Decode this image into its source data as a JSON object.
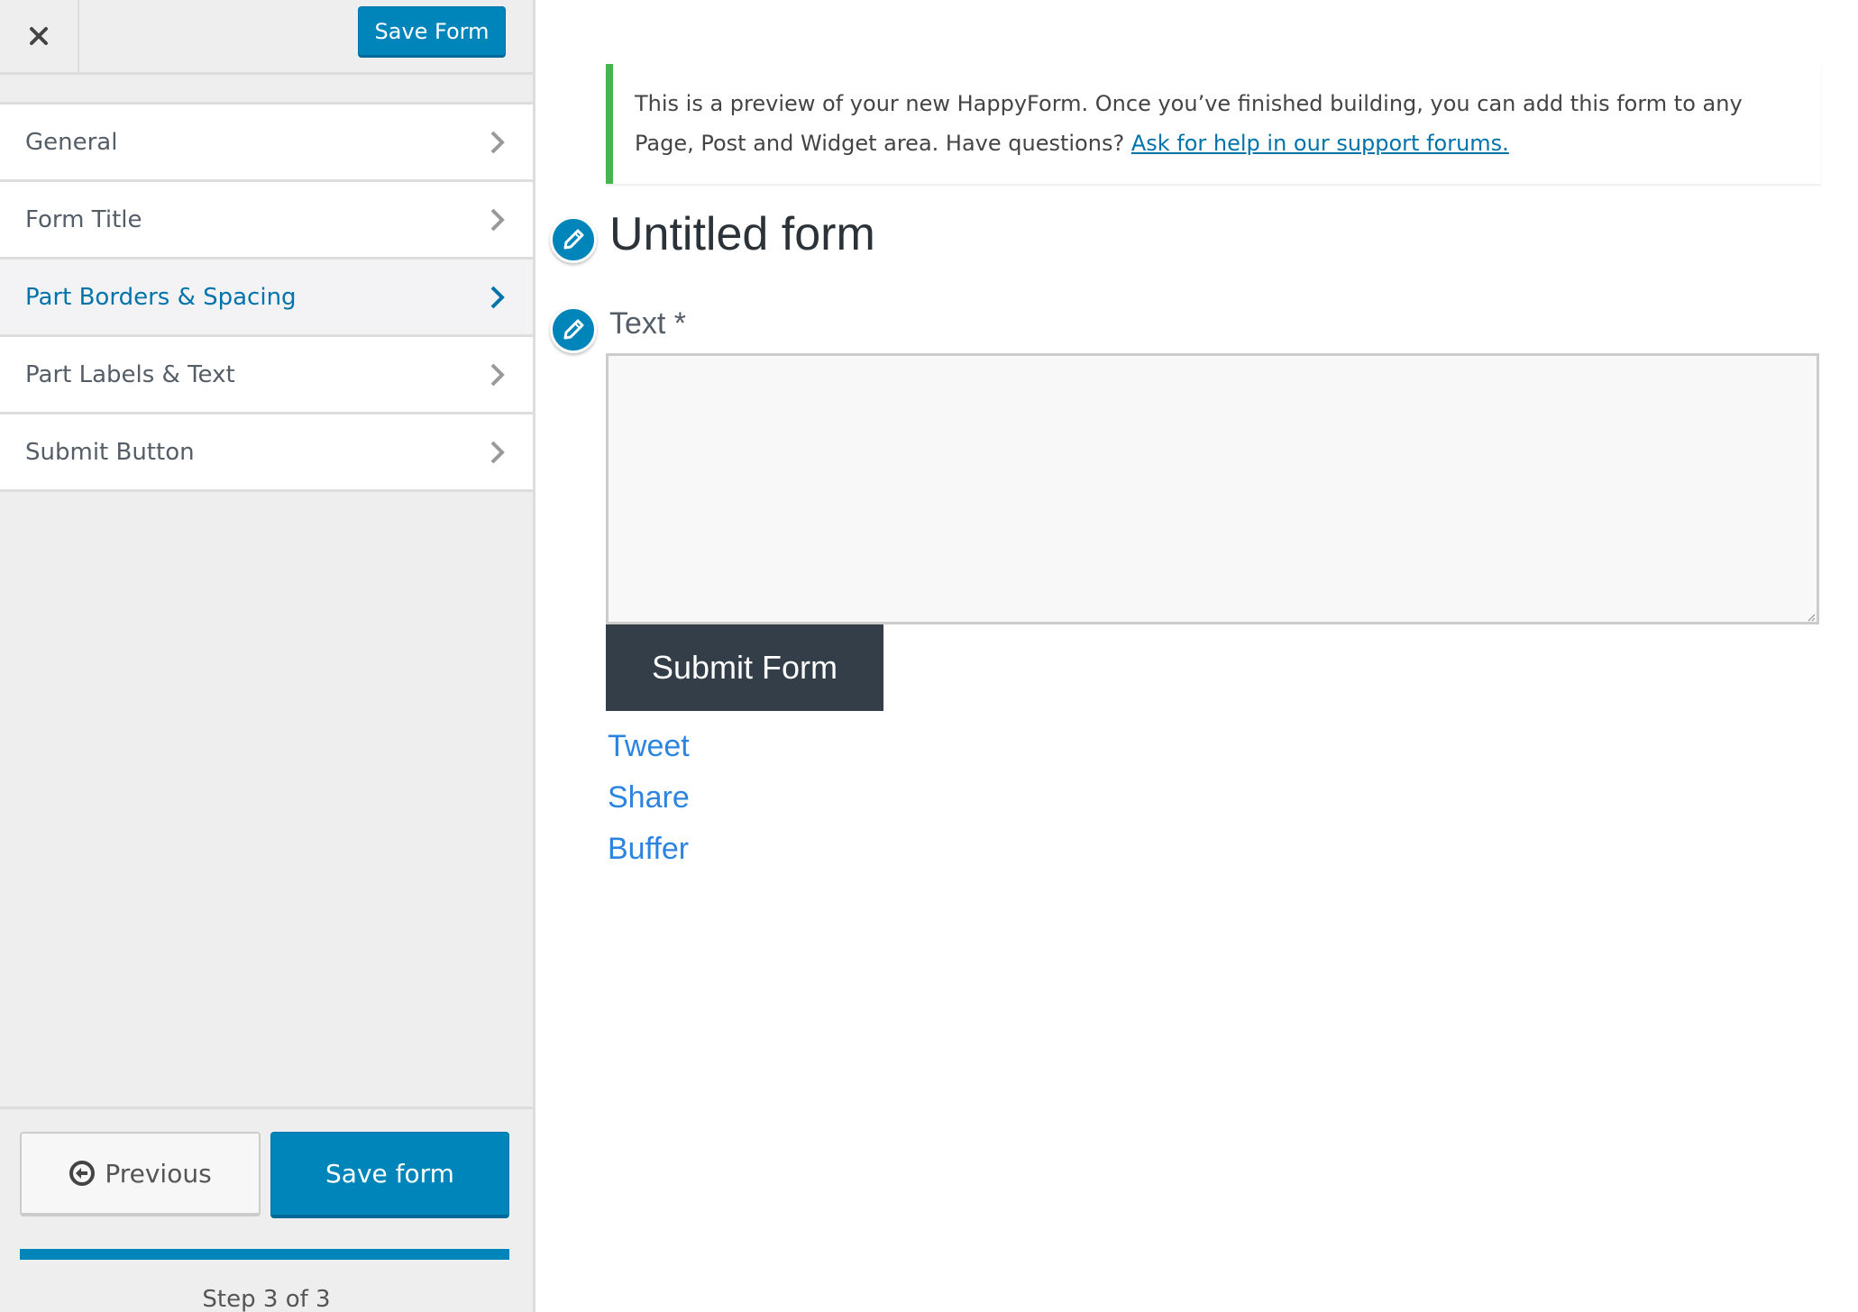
{
  "sidebar": {
    "close_icon": "close-icon",
    "save_top_label": "Save Form",
    "menu": [
      {
        "label": "General",
        "active": false
      },
      {
        "label": "Form Title",
        "active": false
      },
      {
        "label": "Part Borders & Spacing",
        "active": true
      },
      {
        "label": "Part Labels & Text",
        "active": false
      },
      {
        "label": "Submit Button",
        "active": false
      }
    ],
    "footer": {
      "previous_label": "Previous",
      "save_label": "Save form",
      "progress_percent": 100,
      "step_text": "Step 3 of 3"
    }
  },
  "preview": {
    "notice": {
      "text": "This is a preview of your new HappyForm. Once you’ve finished building, you can add this form to any Page, Post and Widget area. Have questions? ",
      "link_text": "Ask for help in our support forums."
    },
    "form_title": "Untitled form",
    "part_label": "Text *",
    "textarea_value": "",
    "submit_label": "Submit Form",
    "share_links": [
      "Tweet",
      "Share",
      "Buffer"
    ]
  },
  "colors": {
    "accent": "#0085ba",
    "notice_border": "#46b450",
    "submit_bg": "#333e48",
    "link": "#2b84e0"
  }
}
